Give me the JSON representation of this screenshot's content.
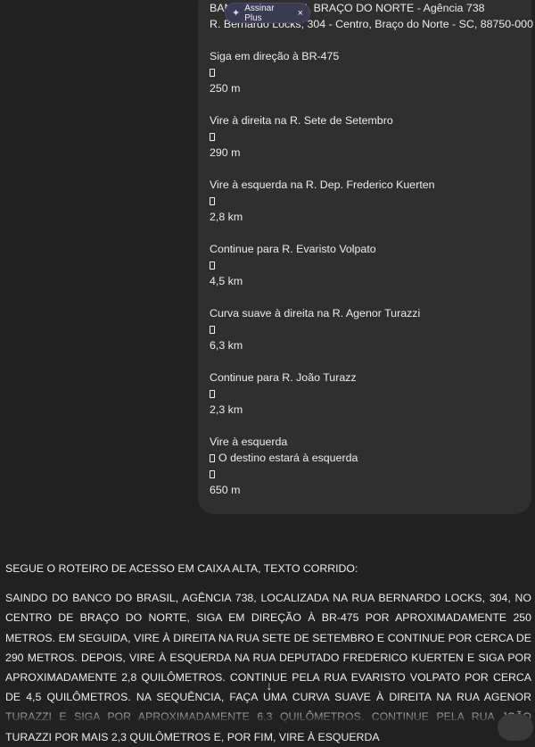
{
  "message": {
    "destination_header": "BANCO DO BRASIL BRAÇO DO NORTE - Agência 738",
    "address": "R. Bernardo Locks, 304 - Centro, Braço do Norte - SC, 88750-000",
    "steps": [
      {
        "instruction": "Siga em direção à BR-475",
        "note": "",
        "distance": "250 m"
      },
      {
        "instruction": "Vire à direita na R. Sete de Setembro",
        "note": "",
        "distance": "290 m"
      },
      {
        "instruction": "Vire à esquerda na R. Dep. Frederico Kuerten",
        "note": "",
        "distance": "2,8 km"
      },
      {
        "instruction": "Continue para R. Evaristo Volpato",
        "note": "",
        "distance": "4,5 km"
      },
      {
        "instruction": "Curva suave à direita na R. Agenor Turazzi",
        "note": "",
        "distance": "6,3 km"
      },
      {
        "instruction": "Continue para R. João Turazz",
        "note": "",
        "distance": "2,3 km"
      },
      {
        "instruction": "Vire à esquerda",
        "note": "O destino estará à esquerda",
        "distance": "650 m"
      }
    ]
  },
  "upgrade_chip": {
    "label": "Assinar Plus",
    "icon": "sparkle-icon",
    "close": "×"
  },
  "answer": {
    "intro": "SEGUE O ROTEIRO DE ACESSO EM CAIXA ALTA, TEXTO CORRIDO:",
    "body": "SAINDO DO BANCO DO BRASIL, AGÊNCIA 738, LOCALIZADA NA RUA BERNARDO LOCKS, 304, NO CENTRO DE BRAÇO DO NORTE, SIGA EM DIREÇÃO À BR-475 POR APROXIMADAMENTE 250 METROS. EM SEGUIDA, VIRE À DIREITA NA RUA SETE DE SETEMBRO E CONTINUE POR CERCA DE 290 METROS. DEPOIS, VIRE À ESQUERDA NA RUA DEPUTADO FREDERICO KUERTEN E SIGA POR APROXIMADAMENTE 2,8 QUILÔMETROS. CONTINUE PELA RUA EVARISTO VOLPATO POR CERCA DE 4,5 QUILÔMETROS. NA SEQUÊNCIA, FAÇA UMA CURVA SUAVE À DIREITA NA RUA AGENOR TURAZZI E SIGA POR APROXIMADAMENTE 6,3 QUILÔMETROS. CONTINUE PELA RUA JOÃO TURAZZI POR MAIS 2,3 QUILÔMETROS E, POR FIM, VIRE À ESQUERDA"
  },
  "scroll_button": {
    "glyph": "↓",
    "icon": "arrow-down-icon"
  },
  "colors": {
    "background": "#212121",
    "bubble": "#2f2f2f",
    "chip": "#3b3a52",
    "text": "#ececec"
  }
}
